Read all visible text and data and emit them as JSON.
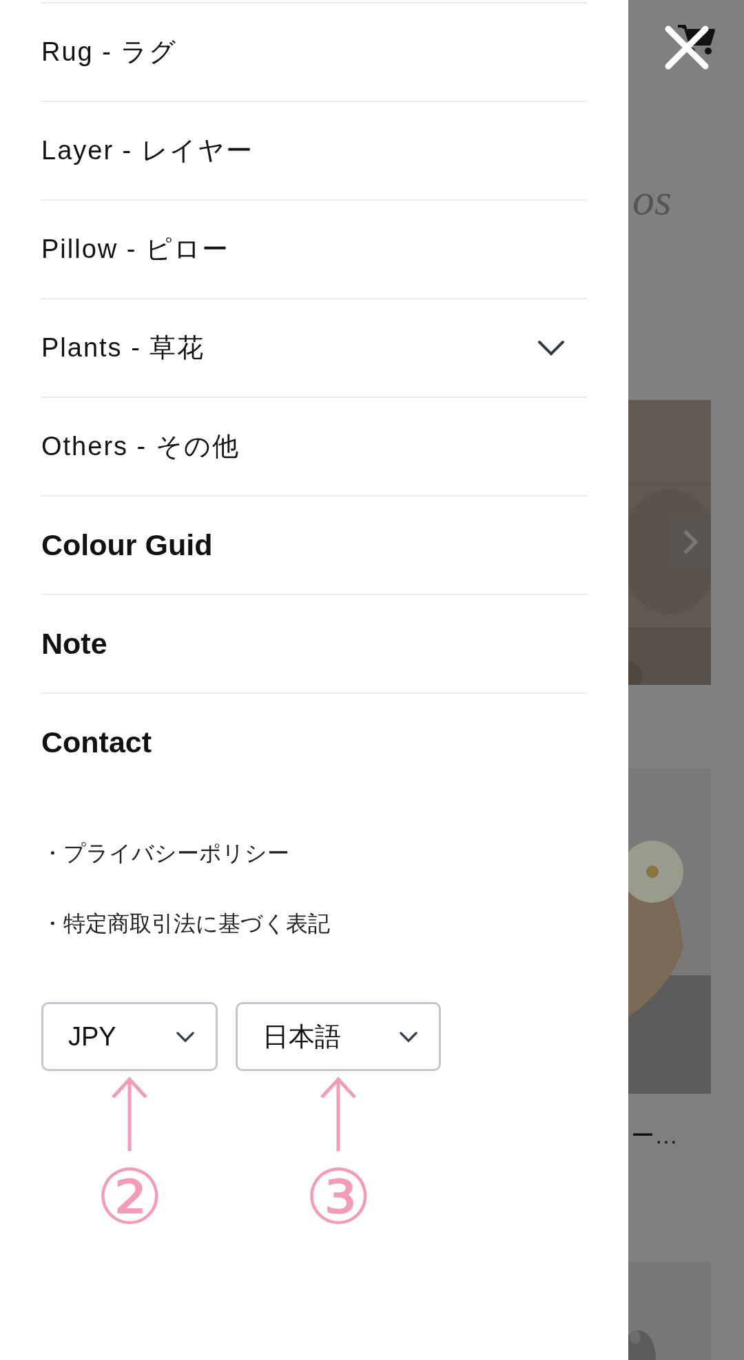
{
  "menu": {
    "items": [
      {
        "label": "Rug - ラグ",
        "kind": "category",
        "expandable": false
      },
      {
        "label": "Layer - レイヤー",
        "kind": "category",
        "expandable": false
      },
      {
        "label": "Pillow - ピロー",
        "kind": "category",
        "expandable": false
      },
      {
        "label": "Plants - 草花",
        "kind": "category",
        "expandable": true
      },
      {
        "label": "Others - その他",
        "kind": "category",
        "expandable": false
      },
      {
        "label": "Colour Guid",
        "kind": "page",
        "expandable": false
      },
      {
        "label": "Note",
        "kind": "page",
        "expandable": false
      },
      {
        "label": "Contact",
        "kind": "page",
        "expandable": false
      }
    ]
  },
  "links": [
    "・プライバシーポリシー",
    "・特定商取引法に基づく表記"
  ],
  "selectors": [
    {
      "value": "JPY"
    },
    {
      "value": "日本語"
    }
  ],
  "annotations": [
    "②",
    "③"
  ],
  "background_page": {
    "logo_fragment": "os",
    "product_title_fragment": "ー…"
  }
}
